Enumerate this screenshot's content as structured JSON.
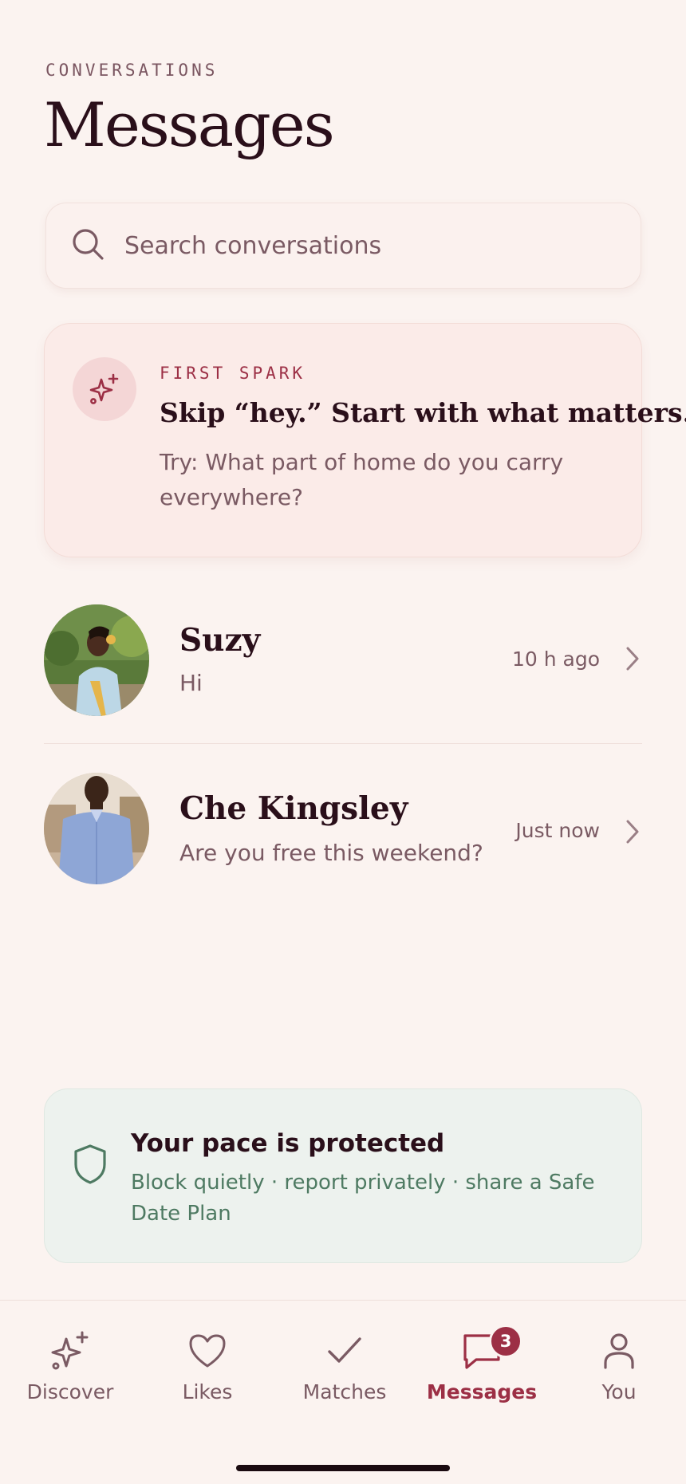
{
  "header": {
    "eyebrow": "CONVERSATIONS",
    "title": "Messages"
  },
  "search": {
    "placeholder": "Search conversations",
    "icon": "search-icon"
  },
  "spark_card": {
    "eyebrow": "FIRST SPARK",
    "title": "Skip “hey.” Start with what matters.",
    "body": "Try: What part of home do you carry everywhere?",
    "icon": "sparkle-icon"
  },
  "conversations": [
    {
      "name": "Suzy",
      "preview": "Hi",
      "time": "10 h ago"
    },
    {
      "name": "Che Kingsley",
      "preview": "Are you free this weekend?",
      "time": "Just now"
    }
  ],
  "safety_card": {
    "title": "Your pace is protected",
    "body": "Block quietly · report privately · share a Safe Date Plan",
    "icon": "shield-icon"
  },
  "tabbar": {
    "tabs": [
      {
        "label": "Discover",
        "icon": "sparkle-icon",
        "active": false
      },
      {
        "label": "Likes",
        "icon": "heart-icon",
        "active": false
      },
      {
        "label": "Matches",
        "icon": "check-icon",
        "active": false
      },
      {
        "label": "Messages",
        "icon": "chat-bubble-icon",
        "active": true,
        "badge": "3"
      },
      {
        "label": "You",
        "icon": "person-icon",
        "active": false
      }
    ]
  },
  "colors": {
    "background": "#fbf3f0",
    "accent": "#9c2f45",
    "text_primary": "#2a0f1a",
    "text_secondary": "#7a5a63",
    "safety_green": "#4e7a62",
    "safety_bg": "#edf2ee"
  }
}
